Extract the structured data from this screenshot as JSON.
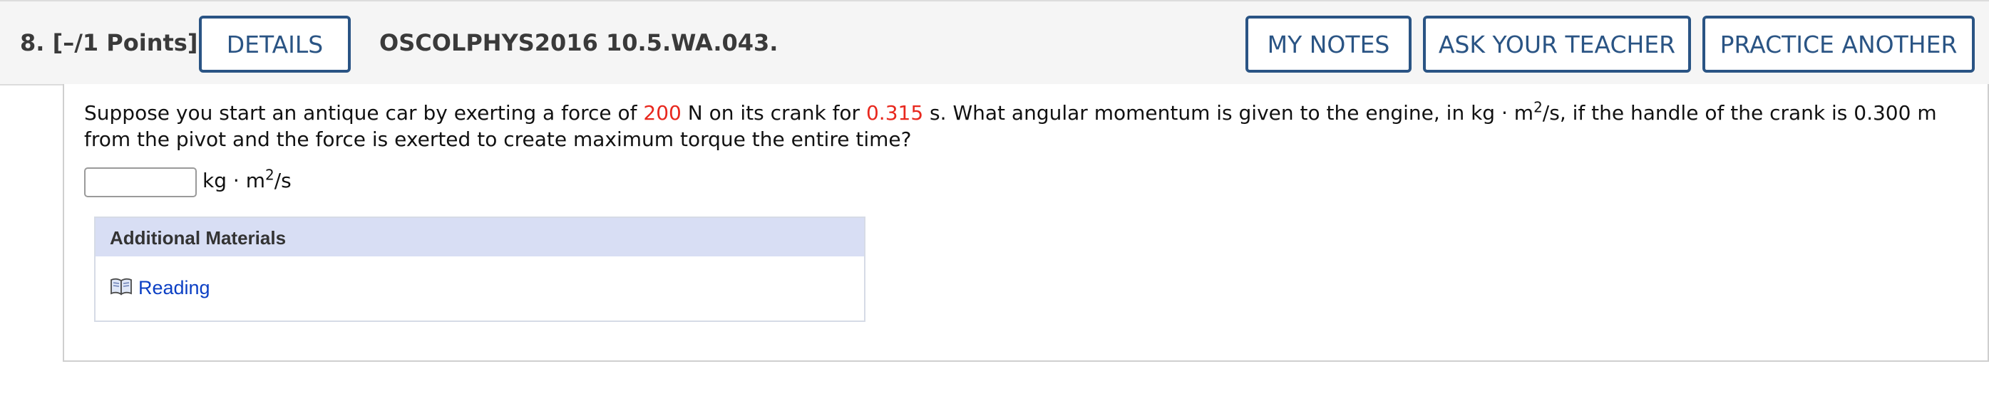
{
  "header": {
    "question_label": "8.  [–/1 Points]",
    "details_label": "DETAILS",
    "problem_code": "OSCOLPHYS2016 10.5.WA.043.",
    "my_notes_label": "MY NOTES",
    "ask_teacher_label": "ASK YOUR TEACHER",
    "practice_label": "PRACTICE ANOTHER"
  },
  "question": {
    "part1": "Suppose you start an antique car by exerting a force of ",
    "force_value": "200",
    "part2": " N on its crank for ",
    "time_value": "0.315",
    "part3": " s. What angular momentum is given to the engine, in kg · m",
    "exponent": "2",
    "part4": "/s, if the handle of the crank is 0.300 m from the pivot and the force is exerted to create maximum torque the entire time?"
  },
  "answer": {
    "value": "",
    "units_prefix": "kg · m",
    "units_exponent": "2",
    "units_suffix": "/s"
  },
  "materials": {
    "title": "Additional Materials",
    "reading_label": "Reading",
    "icon": "book-icon"
  },
  "colors": {
    "accent": "#2a5484",
    "highlight_red": "#e8281e",
    "link": "#0b3fc4",
    "materials_header": "#d8def4"
  }
}
